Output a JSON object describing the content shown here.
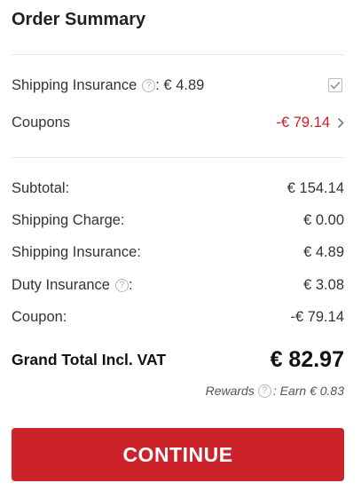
{
  "title": "Order Summary",
  "options": {
    "shipping_insurance_label": "Shipping Insurance",
    "shipping_insurance_value": ": € 4.89",
    "shipping_insurance_checked": true,
    "coupons_label": "Coupons",
    "coupons_value": "-€ 79.14"
  },
  "summary": {
    "subtotal_label": "Subtotal:",
    "subtotal_value": "€ 154.14",
    "shipping_charge_label": "Shipping Charge:",
    "shipping_charge_value": "€ 0.00",
    "shipping_insurance_label": "Shipping Insurance:",
    "shipping_insurance_value": "€ 4.89",
    "duty_insurance_label": "Duty Insurance",
    "duty_insurance_suffix": ":",
    "duty_insurance_value": "€ 3.08",
    "coupon_label": "Coupon:",
    "coupon_value": "-€ 79.14"
  },
  "grand_total": {
    "label": "Grand Total Incl. VAT",
    "value": "€ 82.97"
  },
  "rewards": {
    "label": "Rewards",
    "earn_text": ": Earn € 0.83"
  },
  "continue_label": "CONTINUE",
  "colors": {
    "accent": "#cc2229",
    "coupon_red": "#c8202a"
  }
}
